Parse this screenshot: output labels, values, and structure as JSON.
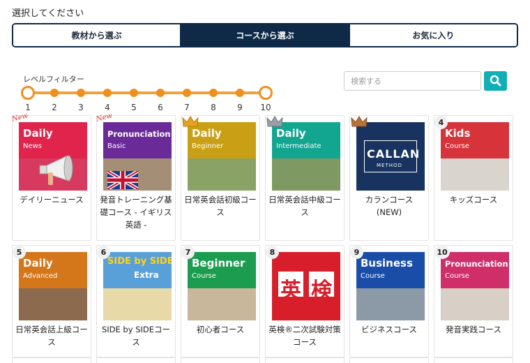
{
  "header": {
    "select_label": "選択してください"
  },
  "tabs": [
    {
      "label": "教材から選ぶ",
      "active": false
    },
    {
      "label": "コースから選ぶ",
      "active": true
    },
    {
      "label": "お気に入り",
      "active": false
    }
  ],
  "level_filter": {
    "title": "レベルフィルター",
    "ticks": [
      "1",
      "2",
      "3",
      "4",
      "5",
      "6",
      "7",
      "8",
      "9",
      "10"
    ],
    "selected_min": 1,
    "selected_max": 10
  },
  "search": {
    "placeholder": "検索する",
    "value": "",
    "icon": "magnifier-icon"
  },
  "courses": [
    {
      "name": "デイリーニュース",
      "thumb_title": "Daily",
      "thumb_sub": "News",
      "badge": "New",
      "band": "#e0244c",
      "photo": "#d8395e"
    },
    {
      "name": "発音トレーニング基礎コース - イギリス英語 -",
      "thumb_title": "Pronunciation",
      "thumb_sub": "Basic",
      "badge": "New",
      "band": "#6a2a98",
      "photo": "#a48f76"
    },
    {
      "name": "日常英会話初級コース",
      "thumb_title": "Daily",
      "thumb_sub": "Beginner",
      "badge": "gold-crown",
      "band": "#c9a015",
      "photo": "#8aa265"
    },
    {
      "name": "日常英会話中級コース",
      "thumb_title": "Daily",
      "thumb_sub": "Intermediate",
      "badge": "silver-crown",
      "band": "#12a58f",
      "photo": "#7e9a62"
    },
    {
      "name": "カランコース(NEW)",
      "thumb_title": "CALLAN",
      "thumb_sub": "METHOD",
      "badge": "bronze-crown",
      "band": "#18335f",
      "photo": "#18335f"
    },
    {
      "name": "キッズコース",
      "thumb_title": "Kids",
      "thumb_sub": "Course",
      "badge": "4",
      "band": "#d6333a",
      "photo": "#d9d4cd"
    },
    {
      "name": "日常英会話上級コース",
      "thumb_title": "Daily",
      "thumb_sub": "Advanced",
      "badge": "5",
      "band": "#d4771a",
      "photo": "#8c6a4d"
    },
    {
      "name": "SIDE by SIDEコース",
      "thumb_title": "SIDE by SIDE",
      "thumb_sub": "Extra",
      "badge": "6",
      "band": "#5aa0d8",
      "photo": "#e7d9a8"
    },
    {
      "name": "初心者コース",
      "thumb_title": "Beginner",
      "thumb_sub": "Course",
      "badge": "7",
      "band": "#1c9c4e",
      "photo": "#c9b79c"
    },
    {
      "name": "英検®二次試験対策コース",
      "thumb_title": "英検",
      "thumb_sub": "",
      "badge": "8",
      "band": "#d81e2a",
      "photo": "#d81e2a"
    },
    {
      "name": "ビジネスコース",
      "thumb_title": "Business",
      "thumb_sub": "Course",
      "badge": "9",
      "band": "#1a4da8",
      "photo": "#8c99a6"
    },
    {
      "name": "発音実践コース",
      "thumb_title": "Pronunciation",
      "thumb_sub": "Course",
      "badge": "10",
      "band": "#d02e68",
      "photo": "#d8cfc6"
    }
  ],
  "colors": {
    "navy": "#0e2a47",
    "orange": "#ef8f1c",
    "teal": "#10aeb6"
  }
}
